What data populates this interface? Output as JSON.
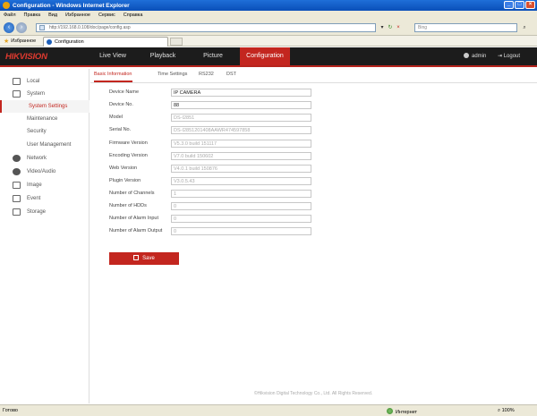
{
  "window": {
    "title": "Configuration - Windows Internet Explorer"
  },
  "menubar": {
    "items": [
      "Файл",
      "Правка",
      "Вид",
      "Избранное",
      "Сервис",
      "Справка"
    ]
  },
  "addressbar": {
    "url": "http://192.168.0.108/doc/page/config.asp",
    "search_placeholder": "Bing"
  },
  "favbar": {
    "favorites_label": "Избранное",
    "tab_title": "Configuration"
  },
  "header": {
    "logo": "HIKVISION",
    "nav": [
      {
        "label": "Live View"
      },
      {
        "label": "Playback"
      },
      {
        "label": "Picture"
      },
      {
        "label": "Configuration"
      }
    ],
    "user": "admin",
    "logout": "Logout"
  },
  "sidebar": {
    "items": [
      {
        "label": "Local",
        "icon": "monitor-icon"
      },
      {
        "label": "System",
        "icon": "system-icon"
      },
      {
        "label": "System Settings"
      },
      {
        "label": "Maintenance"
      },
      {
        "label": "Security"
      },
      {
        "label": "User Management"
      },
      {
        "label": "Network",
        "icon": "globe-icon"
      },
      {
        "label": "Video/Audio",
        "icon": "video-audio-icon"
      },
      {
        "label": "Image",
        "icon": "image-icon"
      },
      {
        "label": "Event",
        "icon": "event-icon"
      },
      {
        "label": "Storage",
        "icon": "storage-icon"
      }
    ]
  },
  "subtabs": [
    "Basic Information",
    "Time Settings",
    "RS232",
    "DST"
  ],
  "form": {
    "fields": [
      {
        "label": "Device Name",
        "value": "IP CAMERA"
      },
      {
        "label": "Device No.",
        "value": "88"
      },
      {
        "label": "Model",
        "value": "DS-I2851"
      },
      {
        "label": "Serial No.",
        "value": "DS-I2851201408AAWR474597858"
      },
      {
        "label": "Firmware Version",
        "value": "V5.3.0 build 151117"
      },
      {
        "label": "Encoding Version",
        "value": "V7.0 build 150602"
      },
      {
        "label": "Web Version",
        "value": "V4.0.1 build 150876"
      },
      {
        "label": "Plugin Version",
        "value": "V3.0.5.43"
      },
      {
        "label": "Number of Channels",
        "value": "1"
      },
      {
        "label": "Number of HDDs",
        "value": "0"
      },
      {
        "label": "Number of Alarm Input",
        "value": "0"
      },
      {
        "label": "Number of Alarm Output",
        "value": "0"
      }
    ],
    "save_label": "Save"
  },
  "footer": "©Hikvision Digital Technology Co., Ltd. All Rights Reserved.",
  "statusbar": {
    "status": "Готово",
    "zone": "Интернет",
    "zoom": "100%"
  }
}
